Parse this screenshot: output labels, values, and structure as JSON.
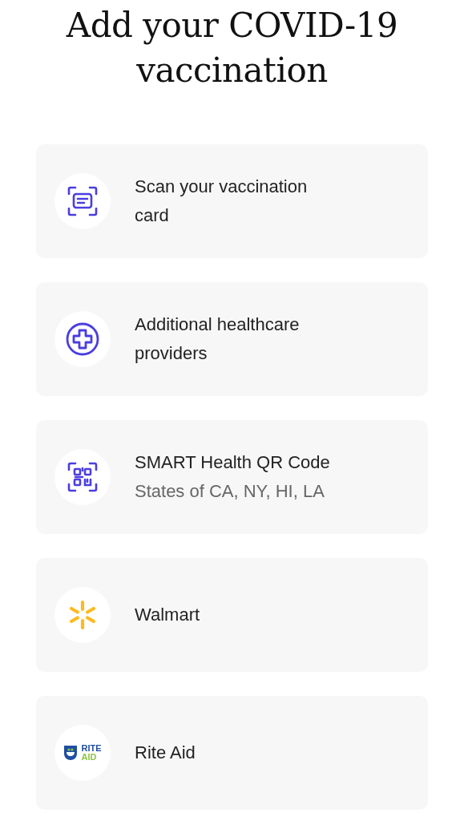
{
  "title": "Add your COVID-19 vaccination",
  "options": [
    {
      "kind": "scan",
      "label": "Scan your vaccination card"
    },
    {
      "kind": "plus",
      "label": "Additional healthcare providers"
    },
    {
      "kind": "qr",
      "label": "SMART Health QR Code",
      "subtitle": "States of CA, NY, HI, LA"
    },
    {
      "kind": "walmart",
      "label": "Walmart"
    },
    {
      "kind": "riteaid",
      "label": "Rite Aid",
      "logo_text": [
        "RITE",
        "AID"
      ]
    }
  ]
}
